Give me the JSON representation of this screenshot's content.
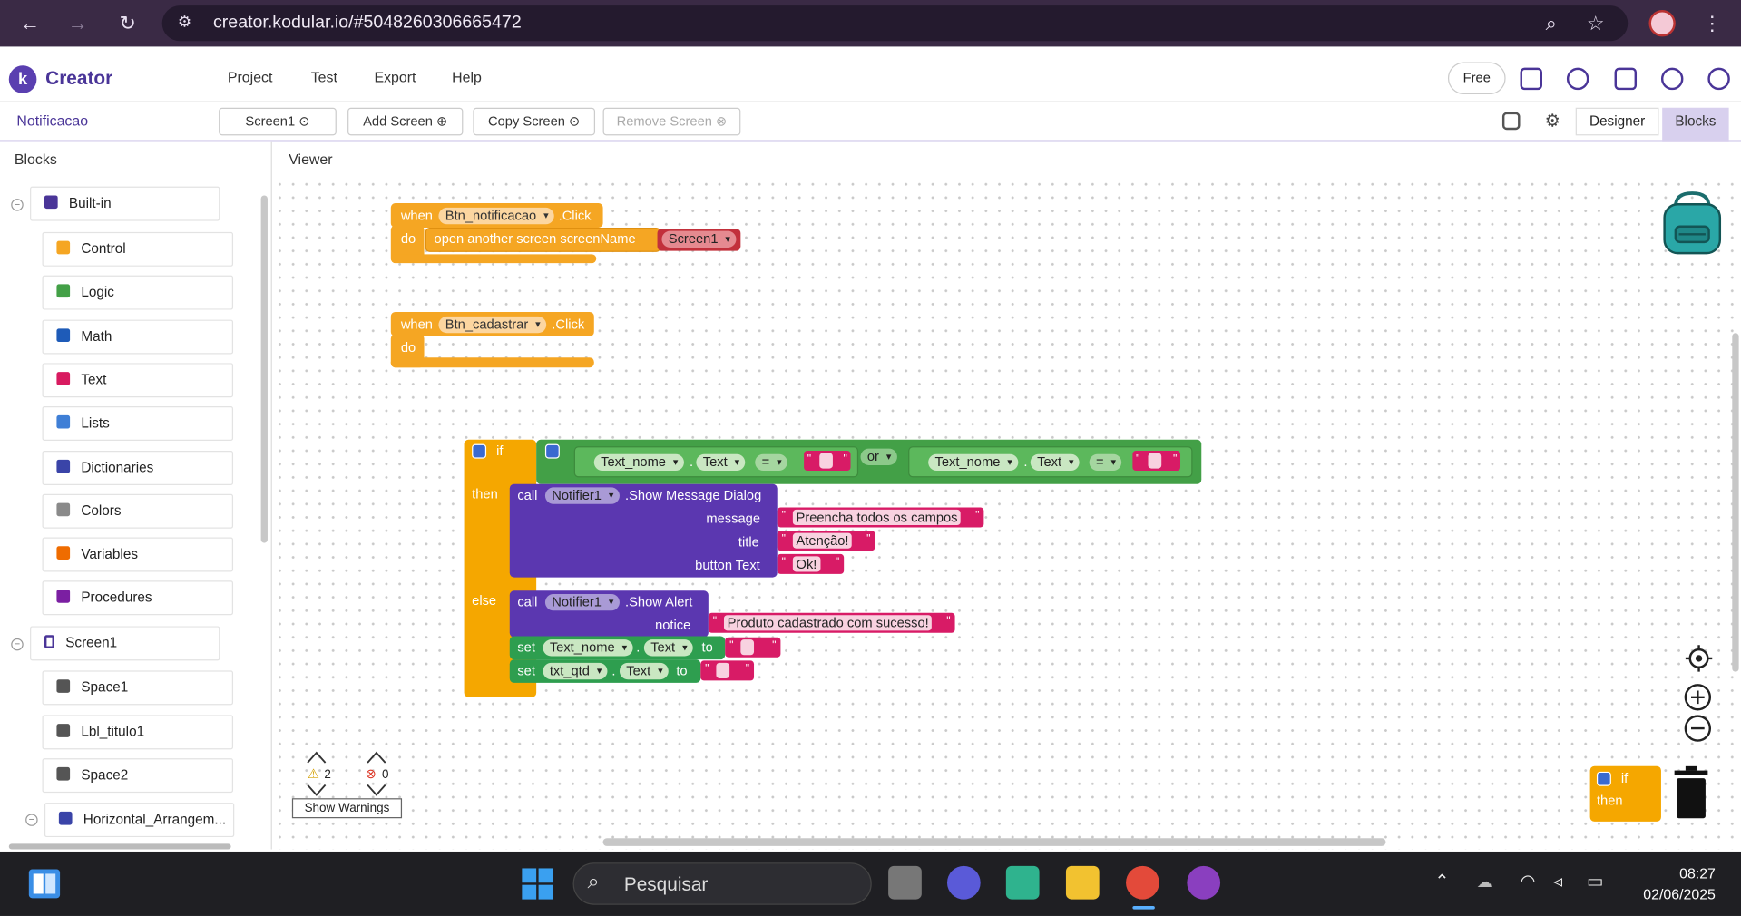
{
  "browser": {
    "url": "creator.kodular.io/#5048260306665472"
  },
  "app": {
    "brand": "Creator",
    "menu": [
      "Project",
      "Test",
      "Export",
      "Help"
    ],
    "free_label": "Free"
  },
  "toolbar": {
    "project_name": "Notificacao",
    "screen_select": "Screen1",
    "add_screen": "Add Screen",
    "copy_screen": "Copy Screen",
    "remove_screen": "Remove Screen",
    "designer_tab": "Designer",
    "blocks_tab": "Blocks"
  },
  "panels": {
    "blocks_title": "Blocks",
    "viewer_title": "Viewer"
  },
  "tree": {
    "builtin_label": "Built-in",
    "builtin_items": [
      {
        "label": "Control",
        "color": "#f5a623"
      },
      {
        "label": "Logic",
        "color": "#43a047"
      },
      {
        "label": "Math",
        "color": "#1e5bb8"
      },
      {
        "label": "Text",
        "color": "#d81b60"
      },
      {
        "label": "Lists",
        "color": "#3f7fd6"
      },
      {
        "label": "Dictionaries",
        "color": "#3a44a8"
      },
      {
        "label": "Colors",
        "color": "#8a8a8a"
      },
      {
        "label": "Variables",
        "color": "#ef6c00"
      },
      {
        "label": "Procedures",
        "color": "#7b1fa2"
      }
    ],
    "screen_label": "Screen1",
    "screen_items": [
      "Space1",
      "Lbl_titulo1",
      "Space2",
      "Horizontal_Arrangem..."
    ]
  },
  "blocks": {
    "when": "when",
    "do": "do",
    "click": ".Click",
    "btn_notificacao": "Btn_notificacao",
    "btn_cadastrar": "Btn_cadastrar",
    "open_screen": "open another screen  screenName",
    "screen1": "Screen1",
    "if": "if",
    "then": "then",
    "else": "else",
    "or": "or",
    "eq": "=",
    "dot": ".",
    "text_nome": "Text_nome",
    "text_prop": "Text",
    "call": "call",
    "notifier": "Notifier1",
    "show_message_dialog": ".Show Message Dialog",
    "message": "message",
    "title": "title",
    "button_text": "button Text",
    "msg_value": "Preencha todos os campos",
    "title_value": "Atenção!",
    "button_value": "Ok!",
    "show_alert": ".Show Alert",
    "notice": "notice",
    "notice_value": "Produto cadastrado com sucesso!",
    "set": "set",
    "to": "to",
    "txt_qtd": "txt_qtd"
  },
  "warnings": {
    "warning_count": "2",
    "error_count": "0",
    "show_warnings": "Show Warnings"
  },
  "taskbar": {
    "search_placeholder": "Pesquisar",
    "time": "08:27",
    "date": "02/06/2025"
  },
  "icons": [
    "back-arrow-icon",
    "forward-arrow-icon",
    "reload-icon",
    "site-settings-icon",
    "zoom-icon",
    "star-icon",
    "menu-dots-icon",
    "backpack-icon",
    "trash-icon",
    "target-icon",
    "zoom-in-icon",
    "zoom-out-icon"
  ],
  "colors": {
    "brand": "#4a3598",
    "event_orange": "#f5a623",
    "if_orange": "#f5a700",
    "green": "#43a047",
    "purple": "#5b37b0",
    "text_pink": "#d81b66",
    "screen_red": "#c2303b"
  }
}
